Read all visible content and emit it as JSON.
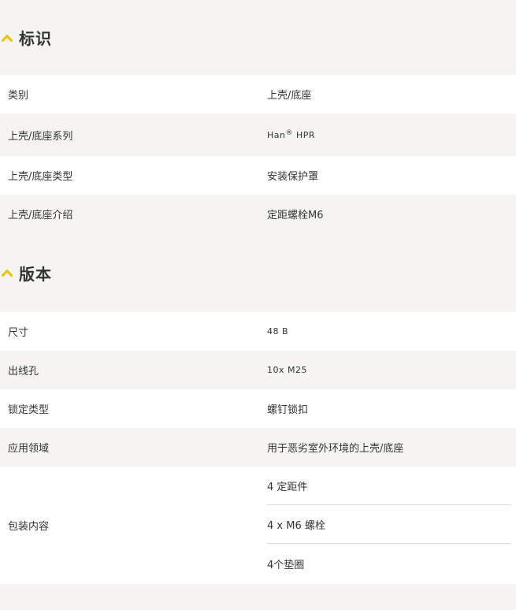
{
  "sections": [
    {
      "title": "标识",
      "rows": [
        {
          "label": "类别",
          "value": "上壳/底座"
        },
        {
          "label": "上壳/底座系列",
          "value_prefix": "Han",
          "value_sup": "®",
          "value_suffix": " HPR"
        },
        {
          "label": "上壳/底座类型",
          "value": "安装保护罩"
        },
        {
          "label": "上壳/底座介绍",
          "value": "定距螺栓M6"
        }
      ]
    },
    {
      "title": "版本",
      "rows": [
        {
          "label": "尺寸",
          "value": "48 B"
        },
        {
          "label": "出线孔",
          "value": "10x M25"
        },
        {
          "label": "锁定类型",
          "value": "螺钉锁扣"
        },
        {
          "label": "应用领域",
          "value": "用于恶劣室外环境的上壳/底座"
        }
      ],
      "package": {
        "label": "包装内容",
        "items": [
          "4 定距件",
          "4 x M6 螺栓",
          "4个垫圈"
        ]
      }
    }
  ],
  "colors": {
    "accent": "#f2c200",
    "band_grey": "#f5f4f0",
    "band_white": "#ffffff"
  },
  "icons": {
    "section_toggle": "chevron-up-icon"
  }
}
